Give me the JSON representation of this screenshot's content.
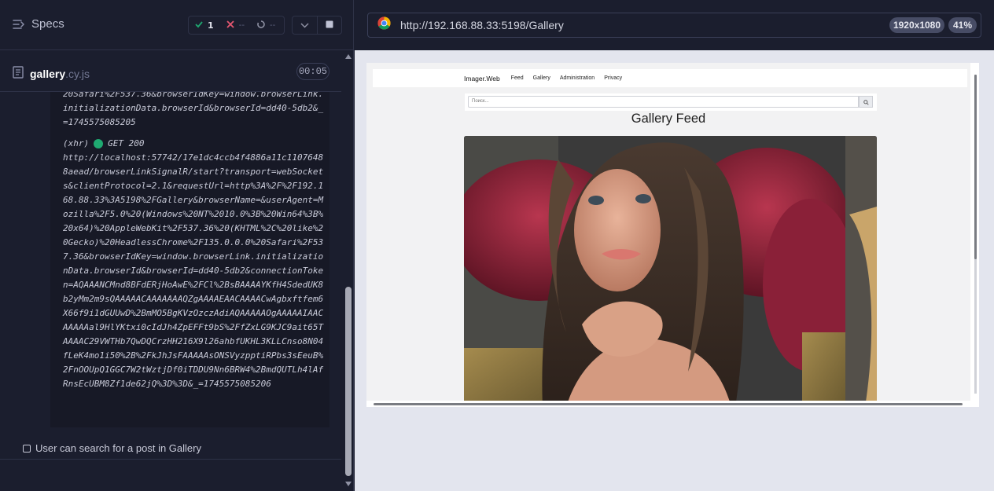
{
  "runner": {
    "specs_label": "Specs",
    "stats": {
      "passed": "1",
      "failed": "--",
      "pending": "--"
    },
    "spec_file": {
      "name": "gallery",
      "ext": ".cy.js",
      "duration": "00:05"
    },
    "log": {
      "previous_tail": "20Safari%2F537.36&browserIdKey=window.browserLink.initializationData.browserId&browserId=dd40-5db2&_=1745575085205",
      "xhr_tag": "(xhr)",
      "xhr_method_status": "GET 200",
      "xhr_url": "http://localhost:57742/17e1dc4ccb4f4886a11c11076488aead/browserLinkSignalR/start?transport=webSockets&clientProtocol=2.1&requestUrl=http%3A%2F%2F192.168.88.33%3A5198%2FGallery&browserName=&userAgent=Mozilla%2F5.0%20(Windows%20NT%2010.0%3B%20Win64%3B%20x64)%20AppleWebKit%2F537.36%20(KHTML%2C%20like%20Gecko)%20HeadlessChrome%2F135.0.0.0%20Safari%2F537.36&browserIdKey=window.browserLink.initializationData.browserId&browserId=dd40-5db2&connectionToken=AQAAANCMnd8BFdERjHoAwE%2FCl%2BsBAAAAYKfH4SdedUK8b2yMm2m9sQAAAAACAAAAAAAQZgAAAAEAACAAAACwAgbxftfem6X66f9i1dGUUwD%2BmMO5BgKVzOzczAdiAQAAAAAOgAAAAAIAACAAAAAal9HlYKtxi0cIdJh4ZpEFFt9bS%2FfZxLG9KJC9ait65TAAAAC29VWTHb7QwDQCrzHH216X9l26ahbfUKHL3KLLCnso8N04fLeK4mo1i50%2B%2FkJhJsFAAAAAsONSVyzpptiRPbs3sEeuB%2FnOOUpQ1GGC7W2tWztjDf0iTDDU9Nn6BRW4%2BmdQUTLh4lAfRnsEcUBM8Zf1de62jQ%3D%3D&_=1745575085206"
    },
    "test": {
      "title": "User can search for a post in Gallery"
    }
  },
  "preview": {
    "url": "http://192.168.88.33:5198/Gallery",
    "viewport": "1920x1080",
    "zoom": "41%",
    "app": {
      "brand": "Imager.Web",
      "nav": [
        "Feed",
        "Gallery",
        "Administration",
        "Privacy"
      ],
      "search_placeholder": "Поиск...",
      "heading": "Gallery Feed"
    }
  },
  "colors": {
    "runner_bg": "#1b1e2e",
    "log_bg": "#171926",
    "pass": "#1fa971",
    "fail": "#e45770",
    "preview_bg": "#e3e5ee"
  }
}
